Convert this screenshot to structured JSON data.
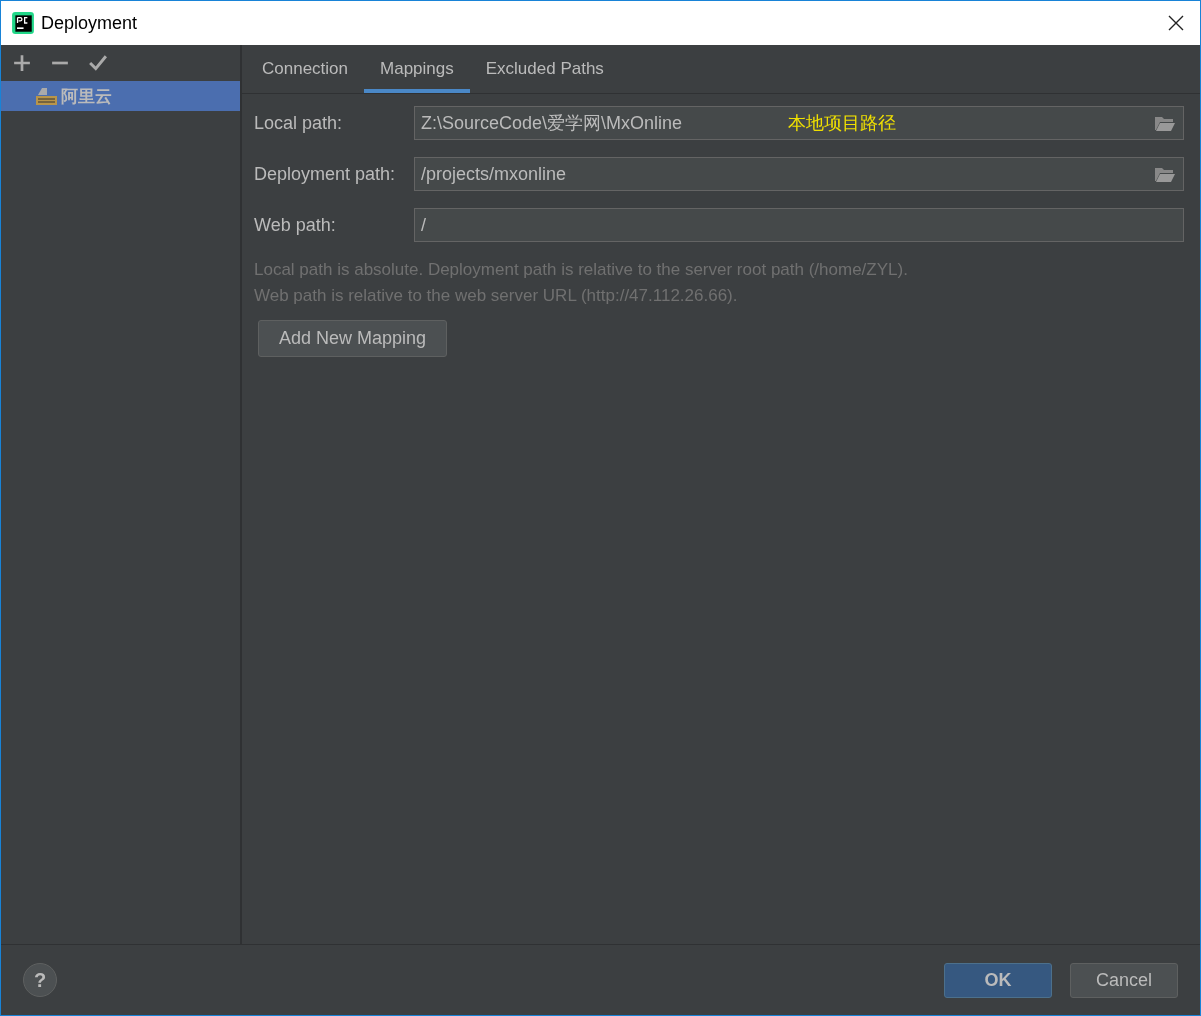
{
  "window": {
    "title": "Deployment"
  },
  "sidebar": {
    "items": [
      {
        "label": "阿里云",
        "selected": true
      }
    ]
  },
  "tabs": [
    {
      "label": "Connection",
      "selected": false
    },
    {
      "label": "Mappings",
      "selected": true
    },
    {
      "label": "Excluded Paths",
      "selected": false
    }
  ],
  "fields": [
    {
      "label": "Local path:",
      "value": "Z:\\SourceCode\\爱学网\\MxOnline",
      "annotation": "本地项目路径",
      "browse": true
    },
    {
      "label": "Deployment path:",
      "value": "/projects/mxonline",
      "browse": true
    },
    {
      "label": "Web path:",
      "value": "/",
      "browse": false
    }
  ],
  "hint": [
    "Local path is absolute. Deployment path is relative to the server root path (/home/ZYL).",
    "Web path is relative to the web server URL (http://47.112.26.66)."
  ],
  "add_button": "Add New Mapping",
  "help": "?",
  "buttons": [
    {
      "label": "OK",
      "kind": "primary"
    },
    {
      "label": "Cancel",
      "kind": "secondary"
    }
  ]
}
